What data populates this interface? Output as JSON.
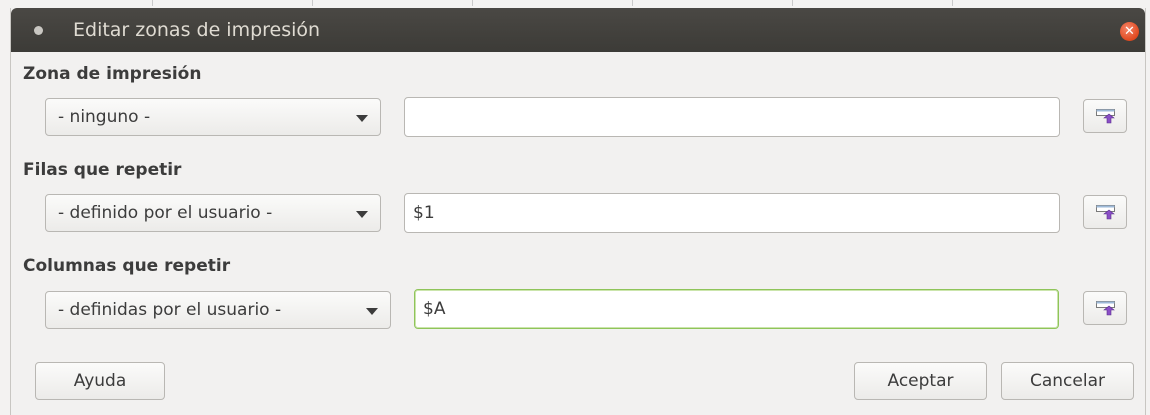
{
  "dialog": {
    "title": "Editar zonas de impresión",
    "close_icon": "close-icon"
  },
  "sections": [
    {
      "label": "Zona de impresión",
      "select_value": "- ninguno -",
      "input_value": "",
      "shrink_icon": "shrink-dialog-icon"
    },
    {
      "label": "Filas que repetir",
      "select_value": "- definido por el usuario -",
      "input_value": "$1",
      "shrink_icon": "shrink-dialog-icon"
    },
    {
      "label": "Columnas que repetir",
      "select_value": "- definidas por el usuario -",
      "input_value": "$A",
      "shrink_icon": "shrink-dialog-icon"
    }
  ],
  "buttons": {
    "help": "Ayuda",
    "ok": "Aceptar",
    "cancel": "Cancelar"
  },
  "colors": {
    "titlebar": "#3c3b37",
    "close": "#e0491f",
    "focus_border": "#8fc45a",
    "icon_arrow": "#8a4fc6"
  }
}
